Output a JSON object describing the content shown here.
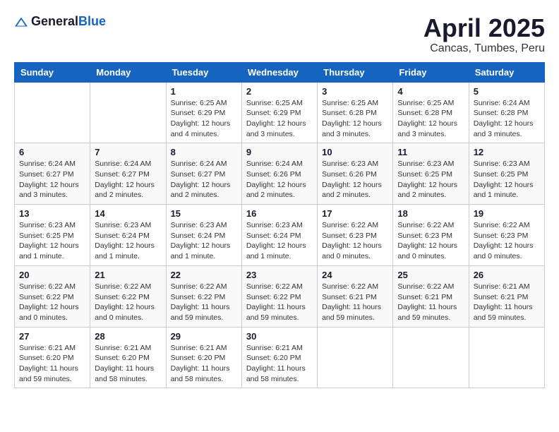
{
  "header": {
    "logo_general": "General",
    "logo_blue": "Blue",
    "month_year": "April 2025",
    "location": "Cancas, Tumbes, Peru"
  },
  "weekdays": [
    "Sunday",
    "Monday",
    "Tuesday",
    "Wednesday",
    "Thursday",
    "Friday",
    "Saturday"
  ],
  "weeks": [
    [
      {
        "day": "",
        "info": ""
      },
      {
        "day": "",
        "info": ""
      },
      {
        "day": "1",
        "info": "Sunrise: 6:25 AM\nSunset: 6:29 PM\nDaylight: 12 hours and 4 minutes."
      },
      {
        "day": "2",
        "info": "Sunrise: 6:25 AM\nSunset: 6:29 PM\nDaylight: 12 hours and 3 minutes."
      },
      {
        "day": "3",
        "info": "Sunrise: 6:25 AM\nSunset: 6:28 PM\nDaylight: 12 hours and 3 minutes."
      },
      {
        "day": "4",
        "info": "Sunrise: 6:25 AM\nSunset: 6:28 PM\nDaylight: 12 hours and 3 minutes."
      },
      {
        "day": "5",
        "info": "Sunrise: 6:24 AM\nSunset: 6:28 PM\nDaylight: 12 hours and 3 minutes."
      }
    ],
    [
      {
        "day": "6",
        "info": "Sunrise: 6:24 AM\nSunset: 6:27 PM\nDaylight: 12 hours and 3 minutes."
      },
      {
        "day": "7",
        "info": "Sunrise: 6:24 AM\nSunset: 6:27 PM\nDaylight: 12 hours and 2 minutes."
      },
      {
        "day": "8",
        "info": "Sunrise: 6:24 AM\nSunset: 6:27 PM\nDaylight: 12 hours and 2 minutes."
      },
      {
        "day": "9",
        "info": "Sunrise: 6:24 AM\nSunset: 6:26 PM\nDaylight: 12 hours and 2 minutes."
      },
      {
        "day": "10",
        "info": "Sunrise: 6:23 AM\nSunset: 6:26 PM\nDaylight: 12 hours and 2 minutes."
      },
      {
        "day": "11",
        "info": "Sunrise: 6:23 AM\nSunset: 6:25 PM\nDaylight: 12 hours and 2 minutes."
      },
      {
        "day": "12",
        "info": "Sunrise: 6:23 AM\nSunset: 6:25 PM\nDaylight: 12 hours and 1 minute."
      }
    ],
    [
      {
        "day": "13",
        "info": "Sunrise: 6:23 AM\nSunset: 6:25 PM\nDaylight: 12 hours and 1 minute."
      },
      {
        "day": "14",
        "info": "Sunrise: 6:23 AM\nSunset: 6:24 PM\nDaylight: 12 hours and 1 minute."
      },
      {
        "day": "15",
        "info": "Sunrise: 6:23 AM\nSunset: 6:24 PM\nDaylight: 12 hours and 1 minute."
      },
      {
        "day": "16",
        "info": "Sunrise: 6:23 AM\nSunset: 6:24 PM\nDaylight: 12 hours and 1 minute."
      },
      {
        "day": "17",
        "info": "Sunrise: 6:22 AM\nSunset: 6:23 PM\nDaylight: 12 hours and 0 minutes."
      },
      {
        "day": "18",
        "info": "Sunrise: 6:22 AM\nSunset: 6:23 PM\nDaylight: 12 hours and 0 minutes."
      },
      {
        "day": "19",
        "info": "Sunrise: 6:22 AM\nSunset: 6:23 PM\nDaylight: 12 hours and 0 minutes."
      }
    ],
    [
      {
        "day": "20",
        "info": "Sunrise: 6:22 AM\nSunset: 6:22 PM\nDaylight: 12 hours and 0 minutes."
      },
      {
        "day": "21",
        "info": "Sunrise: 6:22 AM\nSunset: 6:22 PM\nDaylight: 12 hours and 0 minutes."
      },
      {
        "day": "22",
        "info": "Sunrise: 6:22 AM\nSunset: 6:22 PM\nDaylight: 11 hours and 59 minutes."
      },
      {
        "day": "23",
        "info": "Sunrise: 6:22 AM\nSunset: 6:22 PM\nDaylight: 11 hours and 59 minutes."
      },
      {
        "day": "24",
        "info": "Sunrise: 6:22 AM\nSunset: 6:21 PM\nDaylight: 11 hours and 59 minutes."
      },
      {
        "day": "25",
        "info": "Sunrise: 6:22 AM\nSunset: 6:21 PM\nDaylight: 11 hours and 59 minutes."
      },
      {
        "day": "26",
        "info": "Sunrise: 6:21 AM\nSunset: 6:21 PM\nDaylight: 11 hours and 59 minutes."
      }
    ],
    [
      {
        "day": "27",
        "info": "Sunrise: 6:21 AM\nSunset: 6:20 PM\nDaylight: 11 hours and 59 minutes."
      },
      {
        "day": "28",
        "info": "Sunrise: 6:21 AM\nSunset: 6:20 PM\nDaylight: 11 hours and 58 minutes."
      },
      {
        "day": "29",
        "info": "Sunrise: 6:21 AM\nSunset: 6:20 PM\nDaylight: 11 hours and 58 minutes."
      },
      {
        "day": "30",
        "info": "Sunrise: 6:21 AM\nSunset: 6:20 PM\nDaylight: 11 hours and 58 minutes."
      },
      {
        "day": "",
        "info": ""
      },
      {
        "day": "",
        "info": ""
      },
      {
        "day": "",
        "info": ""
      }
    ]
  ]
}
